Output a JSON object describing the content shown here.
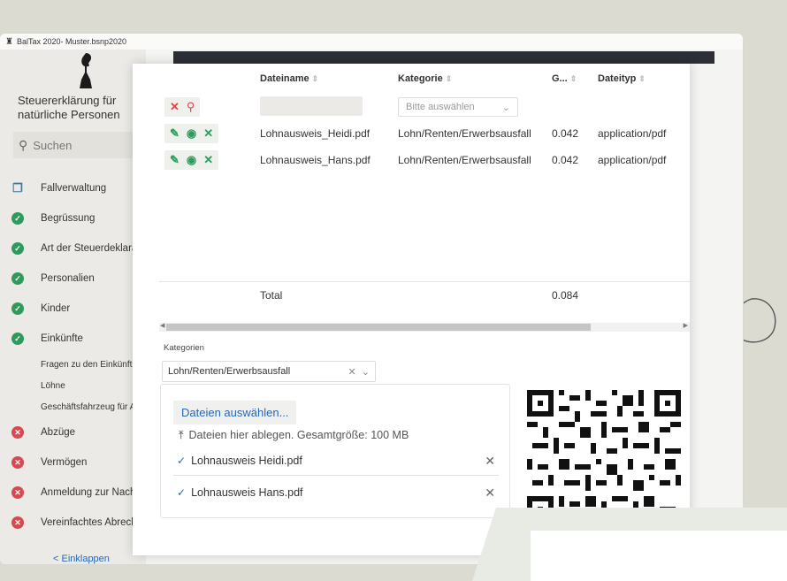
{
  "window": {
    "title": "BalTax 2020- Muster.bsnp2020"
  },
  "sidebar": {
    "title_line1": "Steuererklärung für",
    "title_line2": "natürliche Personen",
    "search_placeholder": "Suchen",
    "items": [
      {
        "label": "Fallverwaltung",
        "status": "folder"
      },
      {
        "label": "Begrüssung",
        "status": "ok"
      },
      {
        "label": "Art der Steuerdeklara",
        "status": "ok"
      },
      {
        "label": "Personalien",
        "status": "ok"
      },
      {
        "label": "Kinder",
        "status": "ok"
      },
      {
        "label": "Einkünfte",
        "status": "ok"
      }
    ],
    "sub_items": [
      {
        "label": "Fragen zu den Einkünft"
      },
      {
        "label": "Löhne"
      },
      {
        "label": "Geschäftsfahrzeug für A"
      }
    ],
    "items2": [
      {
        "label": "Abzüge",
        "status": "err"
      },
      {
        "label": "Vermögen",
        "status": "err"
      },
      {
        "label": "Anmeldung zur Nach",
        "status": "err"
      },
      {
        "label": "Vereinfachtes Abrech",
        "status": "err"
      }
    ],
    "collapse_label": "< Einklappen"
  },
  "table": {
    "headers": {
      "name": "Dateiname",
      "category": "Kategorie",
      "size": "G...",
      "type": "Dateityp"
    },
    "filter_placeholder": "Bitte auswählen",
    "rows": [
      {
        "name": "Lohnausweis_Heidi.pdf",
        "category": "Lohn/Renten/Erwerbsausfall",
        "size": "0.042",
        "type": "application/pdf"
      },
      {
        "name": "Lohnausweis_Hans.pdf",
        "category": "Lohn/Renten/Erwerbsausfall",
        "size": "0.042",
        "type": "application/pdf"
      }
    ],
    "total_label": "Total",
    "total_value": "0.084"
  },
  "upload": {
    "kategorie_label": "Kategorien",
    "kategorie_value": "Lohn/Renten/Erwerbsausfall",
    "select_button": "Dateien auswählen...",
    "drop_hint": "Dateien hier ablegen. Gesamtgröße: 100 MB",
    "files": [
      "Lohnausweis Heidi.pdf",
      "Lohnausweis Hans.pdf"
    ]
  },
  "colors": {
    "ok": "#2e9b5d",
    "err": "#d9474f",
    "link": "#2a67b3"
  }
}
